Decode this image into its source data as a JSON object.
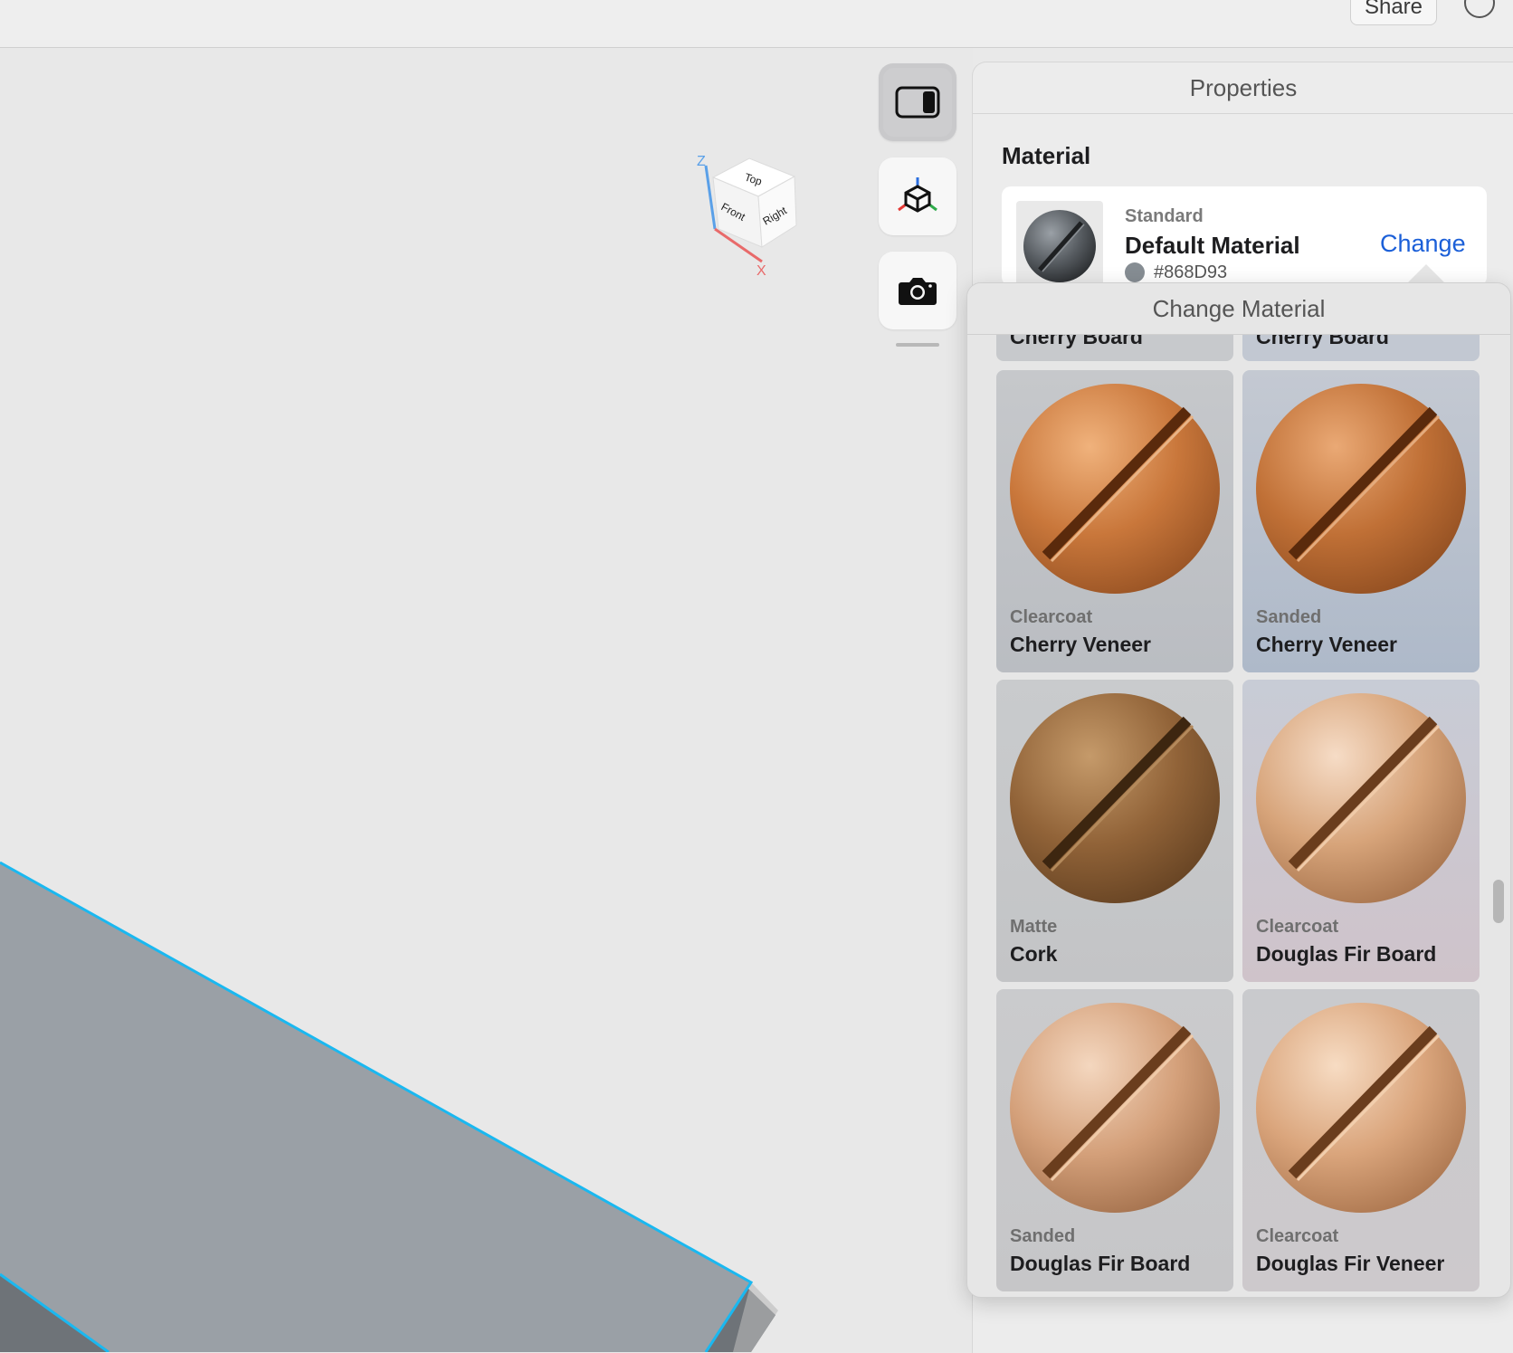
{
  "topbar": {
    "share_label": "Share"
  },
  "properties": {
    "title": "Properties",
    "section_label": "Material",
    "current_material": {
      "type": "Standard",
      "name": "Default Material",
      "hex": "#868D93",
      "change_label": "Change"
    }
  },
  "popover": {
    "title": "Change Material",
    "partial_row": [
      {
        "name": "Cherry Board"
      },
      {
        "name": "Cherry Board"
      }
    ],
    "items": [
      {
        "finish": "Clearcoat",
        "name": "Cherry Veneer"
      },
      {
        "finish": "Sanded",
        "name": "Cherry Veneer"
      },
      {
        "finish": "Matte",
        "name": "Cork"
      },
      {
        "finish": "Clearcoat",
        "name": "Douglas Fir Board"
      },
      {
        "finish": "Sanded",
        "name": "Douglas Fir Board"
      },
      {
        "finish": "Clearcoat",
        "name": "Douglas Fir Veneer"
      }
    ]
  },
  "view_cube": {
    "faces": [
      "Top",
      "Front",
      "Right"
    ],
    "axes": [
      "Z",
      "X"
    ]
  },
  "colors": {
    "accent": "#1b5fd8",
    "selection_edge": "#1ab8f0",
    "model_top": "#9aa0a6",
    "model_side": "#6e7378"
  },
  "icons": [
    "info-icon",
    "panel-toggle-icon",
    "axes-cube-icon",
    "camera-icon"
  ]
}
